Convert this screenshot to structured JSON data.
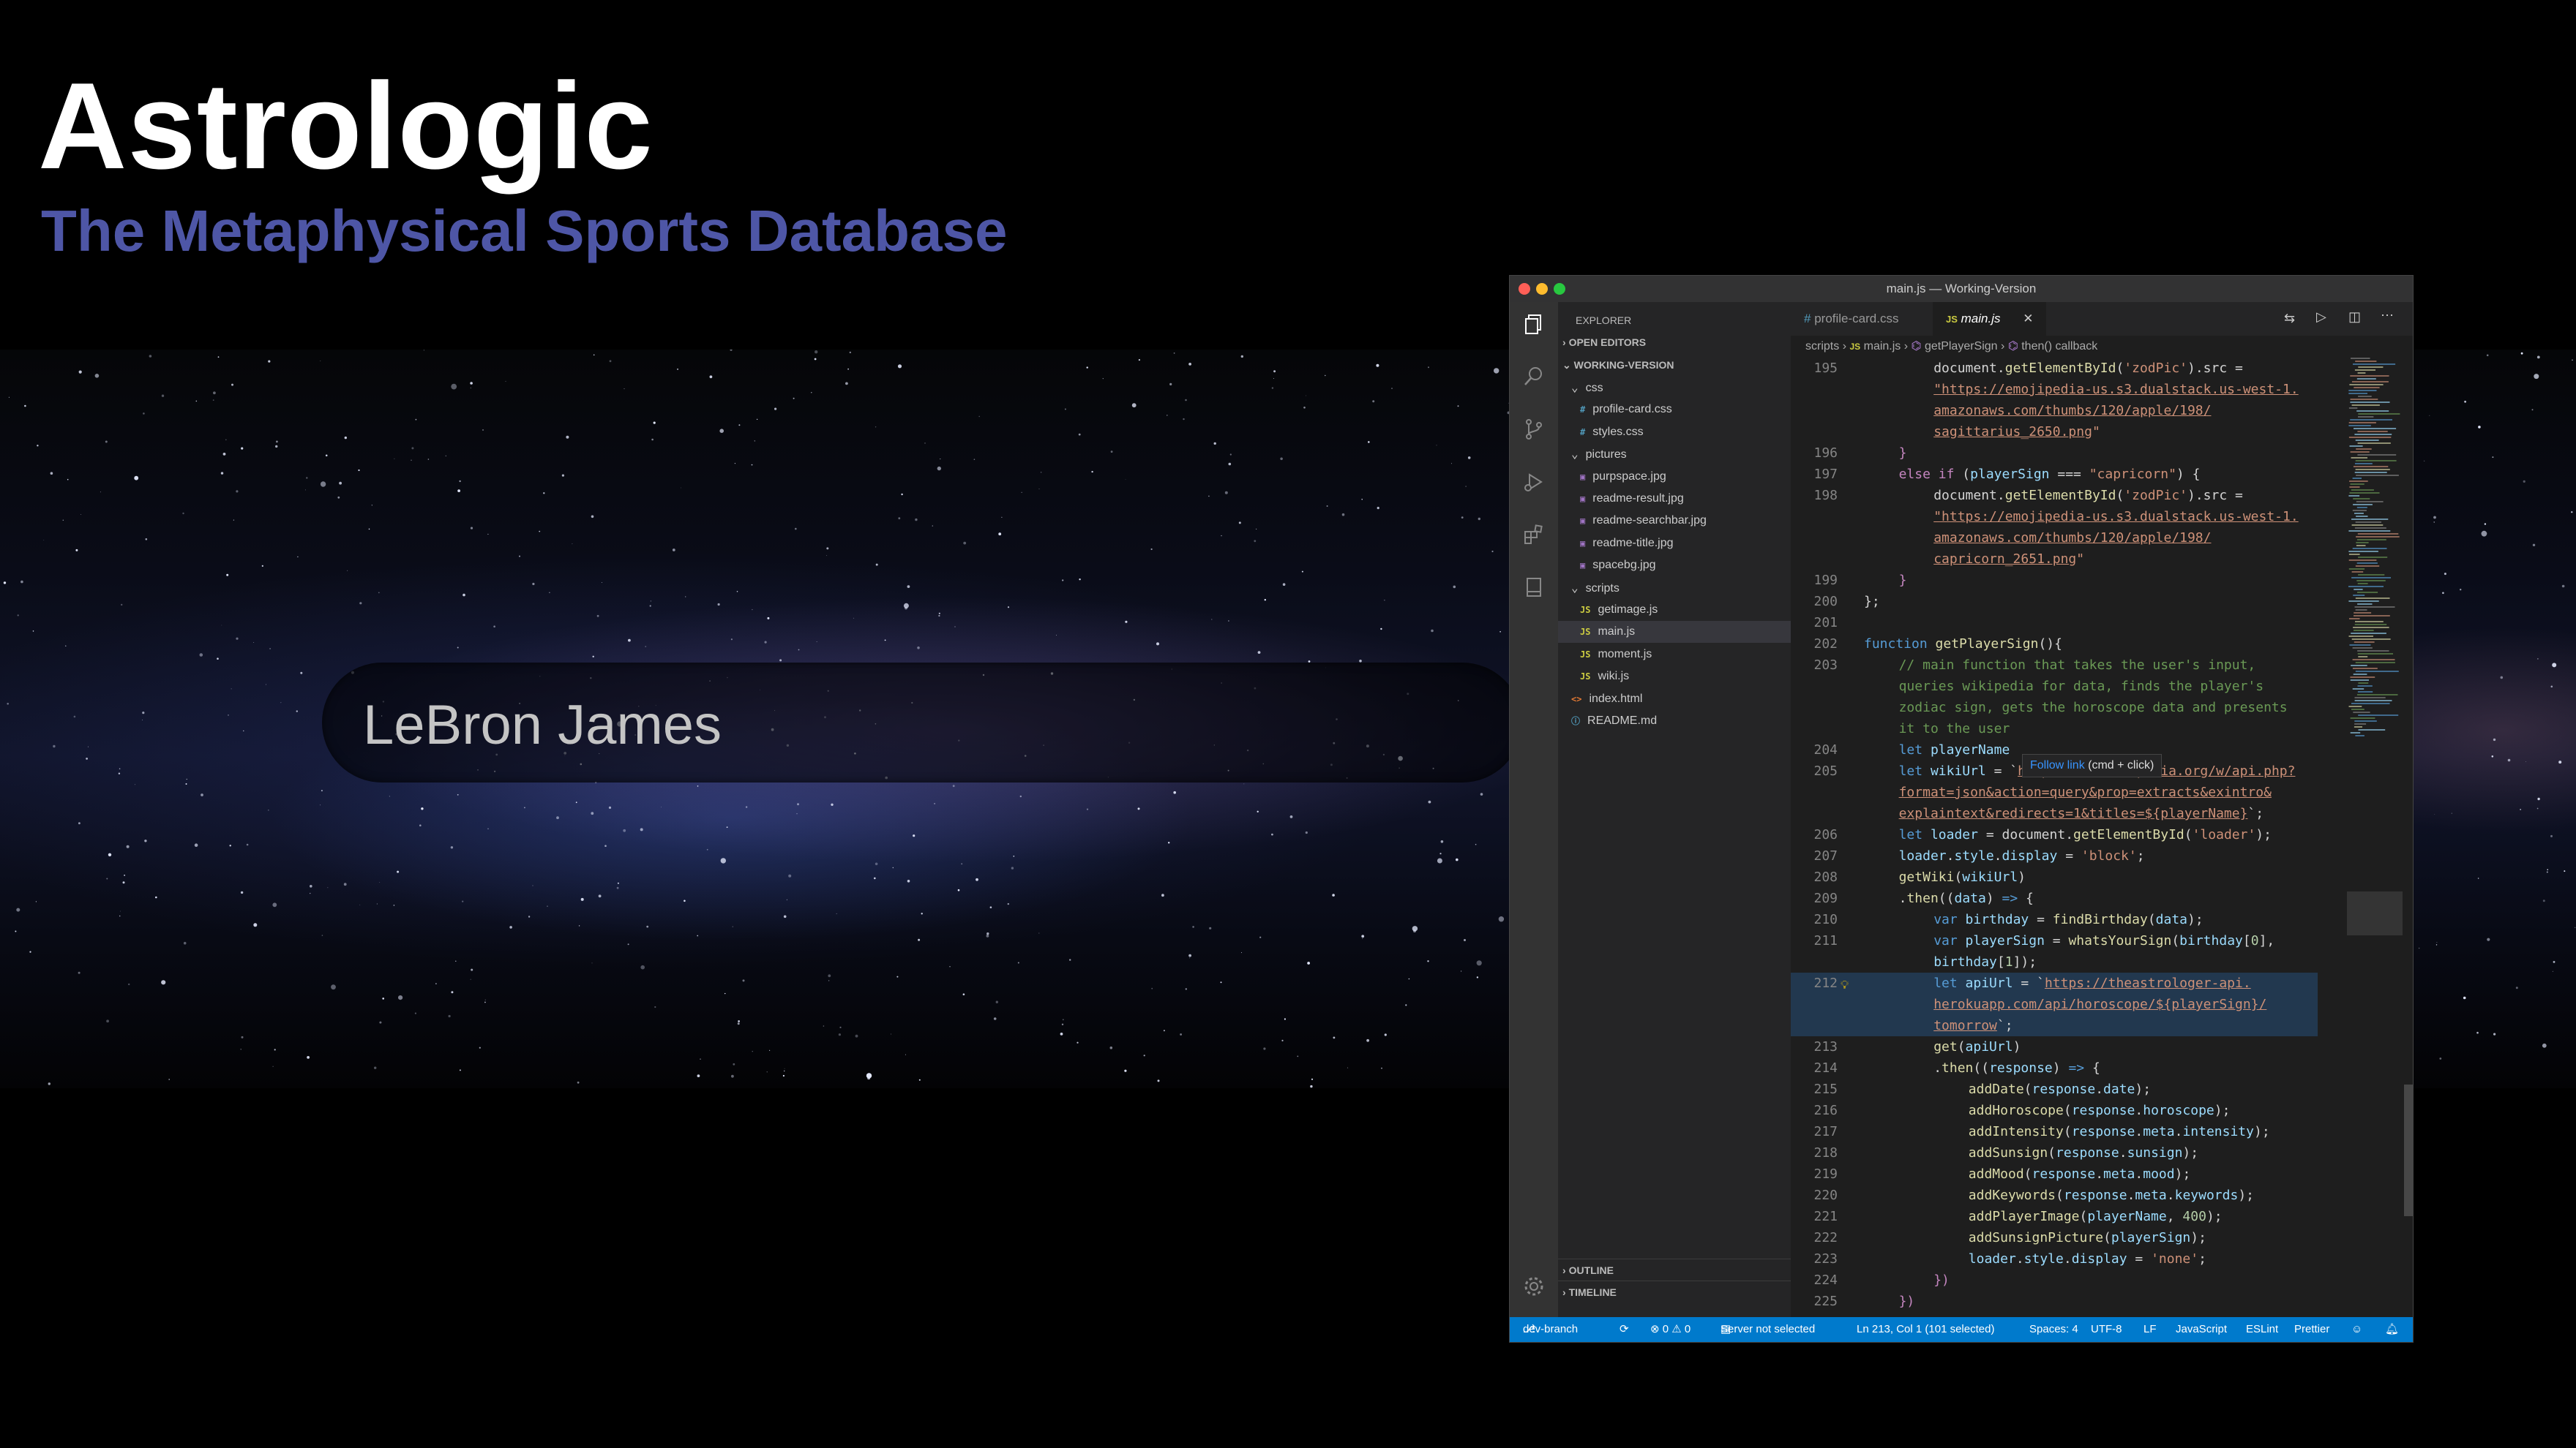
{
  "hero": {
    "title": "Astrologic",
    "subtitle": "The Metaphysical Sports Database",
    "search_value": "LeBron James",
    "subtitle_color": "#4e56a6"
  },
  "window": {
    "title": "main.js — Working-Version"
  },
  "activity_bar": {
    "icons": [
      "files-icon",
      "search-icon",
      "source-control-icon",
      "run-debug-icon",
      "extensions-icon",
      "remote-explorer-icon",
      "settings-gear-icon"
    ]
  },
  "sidebar": {
    "header": "EXPLORER",
    "open_editors": "OPEN EDITORS",
    "workspace": "WORKING-VERSION",
    "tree": [
      {
        "label": "css",
        "kind": "folder",
        "indent": 1
      },
      {
        "label": "profile-card.css",
        "kind": "css",
        "icon": "#",
        "indent": 2
      },
      {
        "label": "styles.css",
        "kind": "css",
        "icon": "#",
        "indent": 2
      },
      {
        "label": "pictures",
        "kind": "folder",
        "indent": 1
      },
      {
        "label": "purpspace.jpg",
        "kind": "img",
        "icon": "▣",
        "indent": 2
      },
      {
        "label": "readme-result.jpg",
        "kind": "img",
        "icon": "▣",
        "indent": 2
      },
      {
        "label": "readme-searchbar.jpg",
        "kind": "img",
        "icon": "▣",
        "indent": 2
      },
      {
        "label": "readme-title.jpg",
        "kind": "img",
        "icon": "▣",
        "indent": 2
      },
      {
        "label": "spacebg.jpg",
        "kind": "img",
        "icon": "▣",
        "indent": 2
      },
      {
        "label": "scripts",
        "kind": "folder",
        "indent": 1
      },
      {
        "label": "getimage.js",
        "kind": "js",
        "icon": "JS",
        "indent": 2
      },
      {
        "label": "main.js",
        "kind": "js",
        "icon": "JS",
        "indent": 2,
        "selected": true
      },
      {
        "label": "moment.js",
        "kind": "js",
        "icon": "JS",
        "indent": 2
      },
      {
        "label": "wiki.js",
        "kind": "js",
        "icon": "JS",
        "indent": 2
      },
      {
        "label": "index.html",
        "kind": "html",
        "icon": "<>",
        "indent": 1
      },
      {
        "label": "README.md",
        "kind": "md",
        "icon": "ⓘ",
        "indent": 1
      }
    ],
    "outline": "OUTLINE",
    "timeline": "TIMELINE"
  },
  "tabs": [
    {
      "label": "profile-card.css",
      "icon": "#",
      "active": false
    },
    {
      "label": "main.js",
      "icon": "JS",
      "active": true
    }
  ],
  "breadcrumb": {
    "folder": "scripts",
    "file": "main.js",
    "symbol": "getPlayerSign",
    "callback": "then() callback"
  },
  "code": [
    {
      "ln": "195",
      "indent": 8,
      "tokens": [
        [
          "pl",
          "document."
        ],
        [
          "fn",
          "getElementById"
        ],
        [
          "pl",
          "("
        ],
        [
          "str2",
          "'zodPic'"
        ],
        [
          "pl",
          ").src = "
        ]
      ]
    },
    {
      "ln": "",
      "indent": 8,
      "tokens": [
        [
          "str",
          "\"https://emojipedia-us.s3.dualstack.us-west-1."
        ]
      ]
    },
    {
      "ln": "",
      "indent": 8,
      "tokens": [
        [
          "str",
          "amazonaws.com/thumbs/120/apple/198/"
        ]
      ]
    },
    {
      "ln": "",
      "indent": 8,
      "tokens": [
        [
          "str",
          "sagittarius_2650.png"
        ],
        [
          "str2",
          "\""
        ]
      ]
    },
    {
      "ln": "196",
      "indent": 4,
      "tokens": [
        [
          "ctl",
          "}"
        ]
      ]
    },
    {
      "ln": "197",
      "indent": 4,
      "tokens": [
        [
          "ctl",
          "else if"
        ],
        [
          "pl",
          " ("
        ],
        [
          "var",
          "playerSign"
        ],
        [
          "pl",
          " === "
        ],
        [
          "str2",
          "\"capricorn\""
        ],
        [
          "pl",
          ") {"
        ]
      ]
    },
    {
      "ln": "198",
      "indent": 8,
      "tokens": [
        [
          "pl",
          "document."
        ],
        [
          "fn",
          "getElementById"
        ],
        [
          "pl",
          "("
        ],
        [
          "str2",
          "'zodPic'"
        ],
        [
          "pl",
          ").src ="
        ]
      ]
    },
    {
      "ln": "",
      "indent": 8,
      "tokens": [
        [
          "str",
          "\"https://emojipedia-us.s3.dualstack.us-west-1."
        ]
      ]
    },
    {
      "ln": "",
      "indent": 8,
      "tokens": [
        [
          "str",
          "amazonaws.com/thumbs/120/apple/198/"
        ]
      ]
    },
    {
      "ln": "",
      "indent": 8,
      "tokens": [
        [
          "str",
          "capricorn_2651.png"
        ],
        [
          "str2",
          "\""
        ]
      ]
    },
    {
      "ln": "199",
      "indent": 4,
      "tokens": [
        [
          "ctl",
          "}"
        ]
      ]
    },
    {
      "ln": "200",
      "indent": 0,
      "tokens": [
        [
          "pl",
          "};"
        ]
      ]
    },
    {
      "ln": "201",
      "indent": 0,
      "tokens": []
    },
    {
      "ln": "202",
      "indent": 0,
      "tokens": [
        [
          "kw",
          "function "
        ],
        [
          "fn",
          "getPlayerSign"
        ],
        [
          "pl",
          "(){"
        ]
      ]
    },
    {
      "ln": "203",
      "indent": 4,
      "tokens": [
        [
          "cm",
          "// main function that takes the user's input,"
        ]
      ]
    },
    {
      "ln": "",
      "indent": 4,
      "tokens": [
        [
          "cm",
          "queries wikipedia for data, finds the player's"
        ]
      ]
    },
    {
      "ln": "",
      "indent": 4,
      "tokens": [
        [
          "cm",
          "zodiac sign, gets the horoscope data and presents"
        ]
      ]
    },
    {
      "ln": "",
      "indent": 4,
      "tokens": [
        [
          "cm",
          "it to the user"
        ]
      ]
    },
    {
      "ln": "204",
      "indent": 4,
      "tokens": [
        [
          "kw",
          "let "
        ],
        [
          "var",
          "playerName"
        ]
      ]
    },
    {
      "ln": "205",
      "indent": 4,
      "tokens": [
        [
          "kw",
          "let "
        ],
        [
          "var",
          "wikiUrl"
        ],
        [
          "pl",
          " = `"
        ],
        [
          "str",
          "https://en.wikipedia.org/w/api.php?"
        ]
      ]
    },
    {
      "ln": "",
      "indent": 4,
      "tokens": [
        [
          "str",
          "format=json&action=query&prop=extracts&exintro&"
        ]
      ]
    },
    {
      "ln": "",
      "indent": 4,
      "tokens": [
        [
          "str",
          "explaintext&redirects=1&titles=${playerName}"
        ],
        [
          "pl",
          "`;"
        ]
      ]
    },
    {
      "ln": "206",
      "indent": 4,
      "tokens": [
        [
          "kw",
          "let "
        ],
        [
          "var",
          "loader"
        ],
        [
          "pl",
          " = document."
        ],
        [
          "fn",
          "getElementById"
        ],
        [
          "pl",
          "("
        ],
        [
          "str2",
          "'loader'"
        ],
        [
          "pl",
          ");"
        ]
      ]
    },
    {
      "ln": "207",
      "indent": 4,
      "tokens": [
        [
          "var",
          "loader"
        ],
        [
          "pl",
          "."
        ],
        [
          "var",
          "style"
        ],
        [
          "pl",
          "."
        ],
        [
          "var",
          "display"
        ],
        [
          "pl",
          " = "
        ],
        [
          "str2",
          "'block'"
        ],
        [
          "pl",
          ";"
        ]
      ]
    },
    {
      "ln": "208",
      "indent": 4,
      "tokens": [
        [
          "fn",
          "getWiki"
        ],
        [
          "pl",
          "("
        ],
        [
          "var",
          "wikiUrl"
        ],
        [
          "pl",
          ")"
        ]
      ]
    },
    {
      "ln": "209",
      "indent": 4,
      "tokens": [
        [
          "pl",
          "."
        ],
        [
          "fn",
          "then"
        ],
        [
          "pl",
          "(("
        ],
        [
          "var",
          "data"
        ],
        [
          "pl",
          ") "
        ],
        [
          "kw",
          "=>"
        ],
        [
          "pl",
          " {"
        ]
      ]
    },
    {
      "ln": "210",
      "indent": 8,
      "tokens": [
        [
          "kw",
          "var "
        ],
        [
          "var",
          "birthday"
        ],
        [
          "pl",
          " = "
        ],
        [
          "fn",
          "findBirthday"
        ],
        [
          "pl",
          "("
        ],
        [
          "var",
          "data"
        ],
        [
          "pl",
          ");"
        ]
      ]
    },
    {
      "ln": "211",
      "indent": 8,
      "tokens": [
        [
          "kw",
          "var "
        ],
        [
          "var",
          "playerSign"
        ],
        [
          "pl",
          " = "
        ],
        [
          "fn",
          "whatsYourSign"
        ],
        [
          "pl",
          "("
        ],
        [
          "var",
          "birthday"
        ],
        [
          "pl",
          "["
        ],
        [
          "num",
          "0"
        ],
        [
          "pl",
          "],"
        ]
      ]
    },
    {
      "ln": "",
      "indent": 8,
      "tokens": [
        [
          "var",
          "birthday"
        ],
        [
          "pl",
          "["
        ],
        [
          "num",
          "1"
        ],
        [
          "pl",
          "]);"
        ]
      ]
    },
    {
      "ln": "212",
      "indent": 8,
      "tokens": [
        [
          "kw",
          "let "
        ],
        [
          "var",
          "apiUrl"
        ],
        [
          "pl",
          " = `"
        ],
        [
          "str",
          "https://theastrologer-api."
        ]
      ]
    },
    {
      "ln": "",
      "indent": 8,
      "tokens": [
        [
          "str",
          "herokuapp.com/api/horoscope/${playerSign}/"
        ]
      ]
    },
    {
      "ln": "",
      "indent": 8,
      "tokens": [
        [
          "str",
          "tomorrow"
        ],
        [
          "pl",
          "`;"
        ]
      ]
    },
    {
      "ln": "213",
      "indent": 8,
      "tokens": [
        [
          "fn",
          "get"
        ],
        [
          "pl",
          "("
        ],
        [
          "var",
          "apiUrl"
        ],
        [
          "pl",
          ")"
        ]
      ]
    },
    {
      "ln": "214",
      "indent": 8,
      "tokens": [
        [
          "pl",
          "."
        ],
        [
          "fn",
          "then"
        ],
        [
          "pl",
          "(("
        ],
        [
          "var",
          "response"
        ],
        [
          "pl",
          ") "
        ],
        [
          "kw",
          "=>"
        ],
        [
          "pl",
          " {"
        ]
      ]
    },
    {
      "ln": "215",
      "indent": 12,
      "tokens": [
        [
          "fn",
          "addDate"
        ],
        [
          "pl",
          "("
        ],
        [
          "var",
          "response"
        ],
        [
          "pl",
          "."
        ],
        [
          "var",
          "date"
        ],
        [
          "pl",
          ");"
        ]
      ]
    },
    {
      "ln": "216",
      "indent": 12,
      "tokens": [
        [
          "fn",
          "addHoroscope"
        ],
        [
          "pl",
          "("
        ],
        [
          "var",
          "response"
        ],
        [
          "pl",
          "."
        ],
        [
          "var",
          "horoscope"
        ],
        [
          "pl",
          ");"
        ]
      ]
    },
    {
      "ln": "217",
      "indent": 12,
      "tokens": [
        [
          "fn",
          "addIntensity"
        ],
        [
          "pl",
          "("
        ],
        [
          "var",
          "response"
        ],
        [
          "pl",
          "."
        ],
        [
          "var",
          "meta"
        ],
        [
          "pl",
          "."
        ],
        [
          "var",
          "intensity"
        ],
        [
          "pl",
          ");"
        ]
      ]
    },
    {
      "ln": "218",
      "indent": 12,
      "tokens": [
        [
          "fn",
          "addSunsign"
        ],
        [
          "pl",
          "("
        ],
        [
          "var",
          "response"
        ],
        [
          "pl",
          "."
        ],
        [
          "var",
          "sunsign"
        ],
        [
          "pl",
          ");"
        ]
      ]
    },
    {
      "ln": "219",
      "indent": 12,
      "tokens": [
        [
          "fn",
          "addMood"
        ],
        [
          "pl",
          "("
        ],
        [
          "var",
          "response"
        ],
        [
          "pl",
          "."
        ],
        [
          "var",
          "meta"
        ],
        [
          "pl",
          "."
        ],
        [
          "var",
          "mood"
        ],
        [
          "pl",
          ");"
        ]
      ]
    },
    {
      "ln": "220",
      "indent": 12,
      "tokens": [
        [
          "fn",
          "addKeywords"
        ],
        [
          "pl",
          "("
        ],
        [
          "var",
          "response"
        ],
        [
          "pl",
          "."
        ],
        [
          "var",
          "meta"
        ],
        [
          "pl",
          "."
        ],
        [
          "var",
          "keywords"
        ],
        [
          "pl",
          ");"
        ]
      ]
    },
    {
      "ln": "221",
      "indent": 12,
      "tokens": [
        [
          "fn",
          "addPlayerImage"
        ],
        [
          "pl",
          "("
        ],
        [
          "var",
          "playerName"
        ],
        [
          "pl",
          ", "
        ],
        [
          "num",
          "400"
        ],
        [
          "pl",
          ");"
        ]
      ]
    },
    {
      "ln": "222",
      "indent": 12,
      "tokens": [
        [
          "fn",
          "addSunsignPicture"
        ],
        [
          "pl",
          "("
        ],
        [
          "var",
          "playerSign"
        ],
        [
          "pl",
          ");"
        ]
      ]
    },
    {
      "ln": "223",
      "indent": 12,
      "tokens": [
        [
          "var",
          "loader"
        ],
        [
          "pl",
          "."
        ],
        [
          "var",
          "style"
        ],
        [
          "pl",
          "."
        ],
        [
          "var",
          "display"
        ],
        [
          "pl",
          " = "
        ],
        [
          "str2",
          "'none'"
        ],
        [
          "pl",
          ";"
        ]
      ]
    },
    {
      "ln": "224",
      "indent": 8,
      "tokens": [
        [
          "ctl",
          "})"
        ]
      ]
    },
    {
      "ln": "225",
      "indent": 4,
      "tokens": [
        [
          "ctl",
          "})"
        ]
      ]
    }
  ],
  "hover_tip": {
    "link": "Follow link",
    "hint": "(cmd + click)"
  },
  "status": {
    "branch": "dev-branch",
    "problems": "⊗ 0 ⚠ 0",
    "server": "Server not selected",
    "cursor": "Ln 213, Col 1 (101 selected)",
    "spaces": "Spaces: 4",
    "encoding": "UTF-8",
    "eol": "LF",
    "language": "JavaScript",
    "eslint": "ESLint",
    "prettier": "Prettier"
  },
  "colors": {
    "status_bar": "#007acc",
    "accent_js": "#cbcb41",
    "accent_css": "#519aba",
    "accent_html": "#e37933"
  }
}
